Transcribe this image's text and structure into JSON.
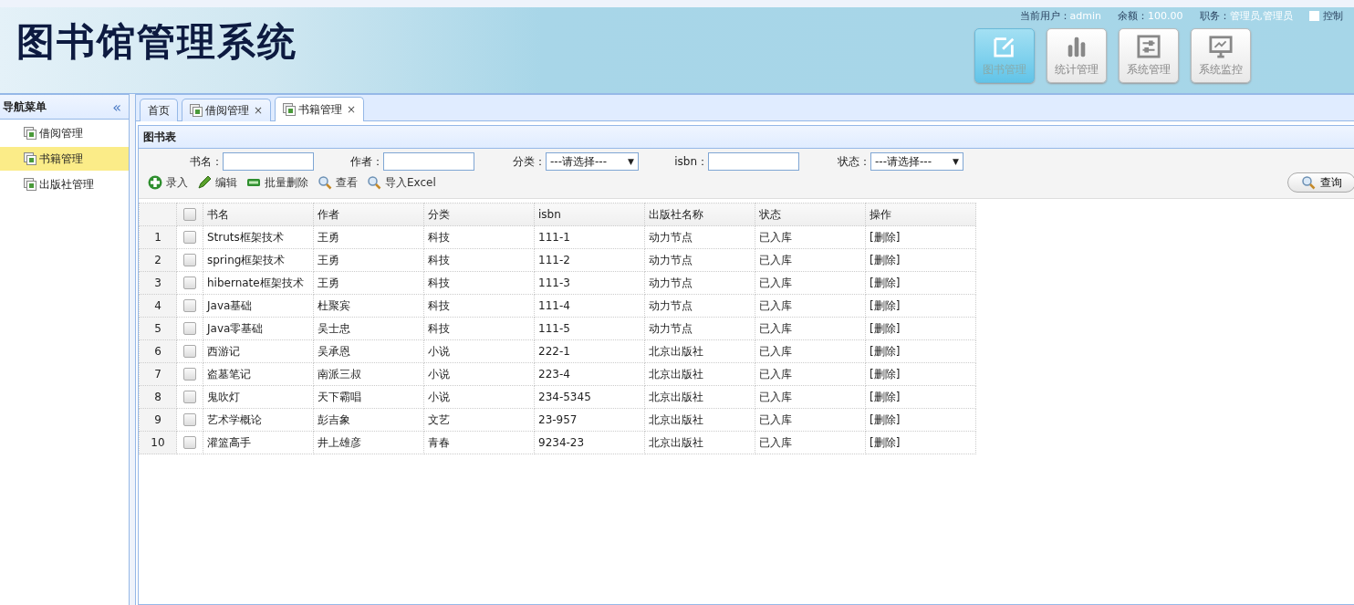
{
  "header": {
    "title": "图书馆管理系统",
    "user_info": [
      {
        "label": "当前用户：",
        "value": "admin"
      },
      {
        "label": "余额：",
        "value": "100.00"
      },
      {
        "label": "职务：",
        "value": "管理员,管理员"
      }
    ],
    "control_panel": {
      "label": "控制",
      "checked": false
    },
    "modules": [
      {
        "label": "图书管理",
        "selected": true
      },
      {
        "label": "统计管理",
        "selected": false
      },
      {
        "label": "系统管理",
        "selected": false
      },
      {
        "label": "系统监控",
        "selected": false
      }
    ]
  },
  "sidebar": {
    "title": "导航菜单",
    "collapse": "«",
    "items": [
      {
        "label": "借阅管理",
        "selected": false
      },
      {
        "label": "书籍管理",
        "selected": true
      },
      {
        "label": "出版社管理",
        "selected": false
      }
    ]
  },
  "tabs": [
    {
      "label": "首页",
      "kind": "home",
      "selected": false
    },
    {
      "label": "借阅管理",
      "kind": "page",
      "selected": false
    },
    {
      "label": "书籍管理",
      "kind": "page",
      "selected": true
    }
  ],
  "tab_close": "×",
  "panel": {
    "title": "图书表",
    "filters": [
      {
        "label": "书名：",
        "kind": "text"
      },
      {
        "label": "作者：",
        "kind": "text"
      },
      {
        "label": "分类：",
        "kind": "select",
        "value": "---请选择---"
      },
      {
        "label": "isbn：",
        "kind": "text"
      },
      {
        "label": "状态：",
        "kind": "select",
        "value": "---请选择---"
      }
    ],
    "select_caret": "▼",
    "toolbar": [
      {
        "label": "录入"
      },
      {
        "label": "编辑"
      },
      {
        "label": "批量删除"
      },
      {
        "label": "查看"
      },
      {
        "label": "导入Excel"
      }
    ],
    "query_button": "查询",
    "table": {
      "select_all_checked": false,
      "columns": [
        "书名",
        "作者",
        "分类",
        "isbn",
        "出版社名称",
        "状态",
        "操作"
      ],
      "rows": [
        {
          "num": "1",
          "checked": false,
          "cells": [
            "Struts框架技术",
            "王勇",
            "科技",
            "111-1",
            "动力节点",
            "已入库",
            "[删除]"
          ]
        },
        {
          "num": "2",
          "checked": false,
          "cells": [
            "spring框架技术",
            "王勇",
            "科技",
            "111-2",
            "动力节点",
            "已入库",
            "[删除]"
          ]
        },
        {
          "num": "3",
          "checked": false,
          "cells": [
            "hibernate框架技术",
            "王勇",
            "科技",
            "111-3",
            "动力节点",
            "已入库",
            "[删除]"
          ]
        },
        {
          "num": "4",
          "checked": false,
          "cells": [
            "Java基础",
            "杜聚宾",
            "科技",
            "111-4",
            "动力节点",
            "已入库",
            "[删除]"
          ]
        },
        {
          "num": "5",
          "checked": false,
          "cells": [
            "Java零基础",
            "吴士忠",
            "科技",
            "111-5",
            "动力节点",
            "已入库",
            "[删除]"
          ]
        },
        {
          "num": "6",
          "checked": false,
          "cells": [
            "西游记",
            "吴承恩",
            "小说",
            "222-1",
            "北京出版社",
            "已入库",
            "[删除]"
          ]
        },
        {
          "num": "7",
          "checked": false,
          "cells": [
            "盗墓笔记",
            "南派三叔",
            "小说",
            "223-4",
            "北京出版社",
            "已入库",
            "[删除]"
          ]
        },
        {
          "num": "8",
          "checked": false,
          "cells": [
            "鬼吹灯",
            "天下霸唱",
            "小说",
            "234-5345",
            "北京出版社",
            "已入库",
            "[删除]"
          ]
        },
        {
          "num": "9",
          "checked": false,
          "cells": [
            "艺术学概论",
            "彭吉象",
            "文艺",
            "23-957",
            "北京出版社",
            "已入库",
            "[删除]"
          ]
        },
        {
          "num": "10",
          "checked": false,
          "cells": [
            "灌篮高手",
            "井上雄彦",
            "青春",
            "9234-23",
            "北京出版社",
            "已入库",
            "[删除]"
          ]
        }
      ]
    }
  }
}
